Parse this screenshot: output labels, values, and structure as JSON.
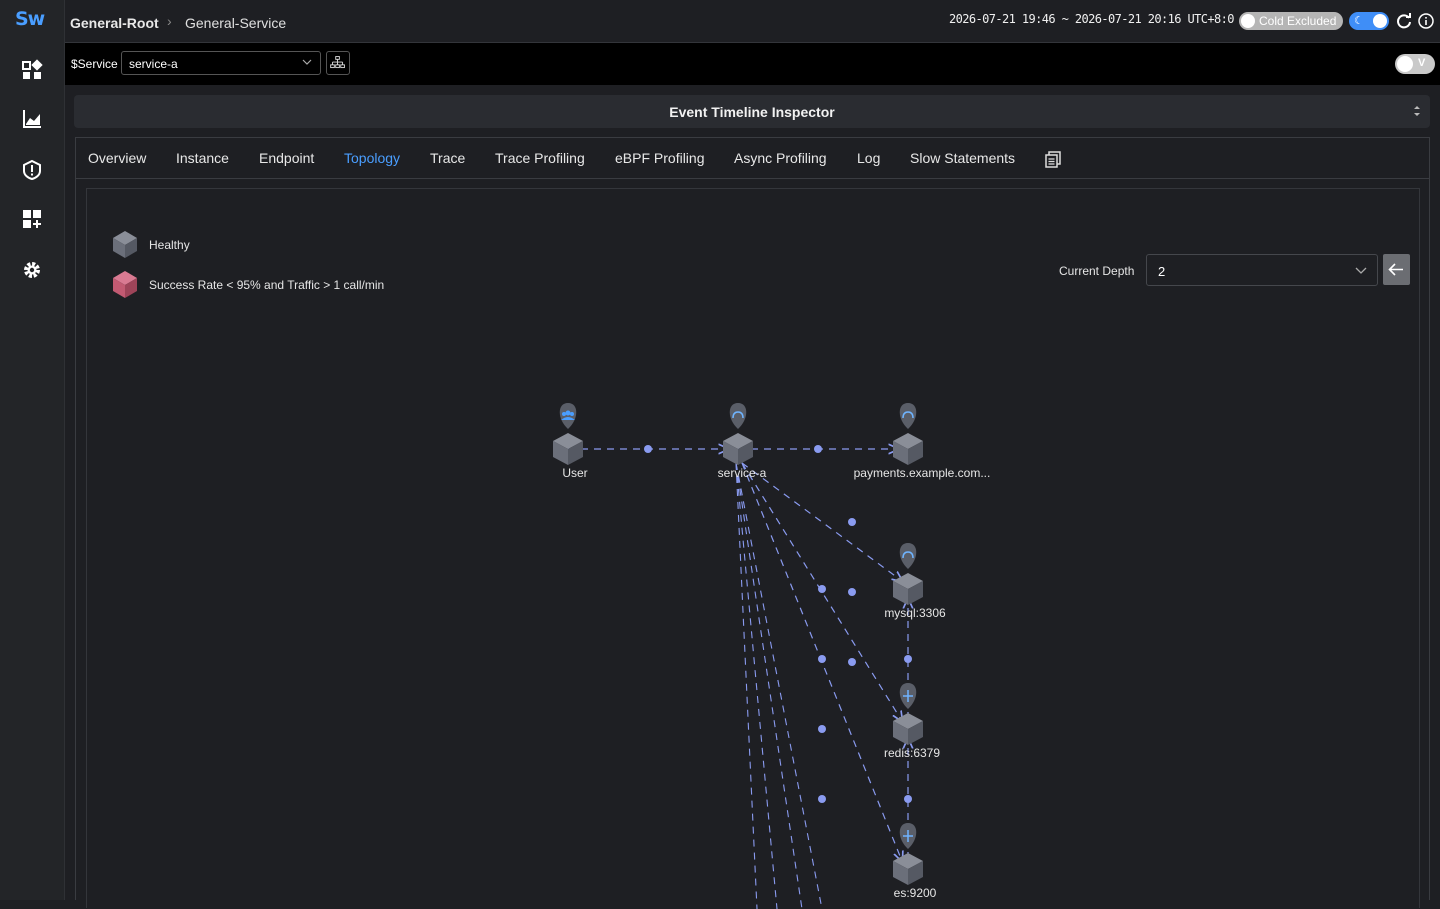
{
  "sidebar": {
    "logo": "Sw",
    "icons": [
      "dashboard-icon",
      "chart-icon",
      "alert-icon",
      "widget-icon",
      "settings-icon"
    ]
  },
  "header": {
    "breadcrumb_root": "General-Root",
    "breadcrumb_leaf": "General-Service",
    "time_range": "2026-07-21 19:46 ~ 2026-07-21 20:16",
    "timezone": "UTC+8:0",
    "cold_label": "Cold Excluded",
    "dark_mode": true
  },
  "service_bar": {
    "label": "$Service",
    "selected": "service-a",
    "v_label": "V"
  },
  "panel": {
    "title": "Event Timeline Inspector"
  },
  "tabs": [
    "Overview",
    "Instance",
    "Endpoint",
    "Topology",
    "Trace",
    "Trace Profiling",
    "eBPF Profiling",
    "Async Profiling",
    "Log",
    "Slow Statements"
  ],
  "active_tab": "Topology",
  "legend": {
    "healthy": "Healthy",
    "unhealthy": "Success Rate < 95% and Traffic > 1 call/min",
    "healthy_color": "#6b6f7a",
    "unhealthy_color": "#c25a72"
  },
  "depth": {
    "label": "Current Depth",
    "value": "2"
  },
  "topology": {
    "nodes": [
      {
        "id": "user",
        "name": "User",
        "icon": "user-icon"
      },
      {
        "id": "service-a",
        "name": "service-a",
        "icon": "cloud-icon"
      },
      {
        "id": "payments",
        "name": "payments.example.com...",
        "icon": "cloud-icon"
      },
      {
        "id": "mysql",
        "name": "mysql:3306",
        "icon": "cloud-icon"
      },
      {
        "id": "redis",
        "name": "redis:6379",
        "icon": "db-icon"
      },
      {
        "id": "es",
        "name": "es:9200",
        "icon": "db-icon"
      }
    ],
    "edges": [
      {
        "from": "user",
        "to": "service-a"
      },
      {
        "from": "service-a",
        "to": "payments"
      },
      {
        "from": "service-a",
        "to": "mysql"
      },
      {
        "from": "service-a",
        "to": "redis"
      },
      {
        "from": "service-a",
        "to": "es"
      },
      {
        "from": "redis",
        "to": "mysql"
      },
      {
        "from": "es",
        "to": "redis"
      }
    ],
    "edge_color": "#8a9bf0"
  }
}
